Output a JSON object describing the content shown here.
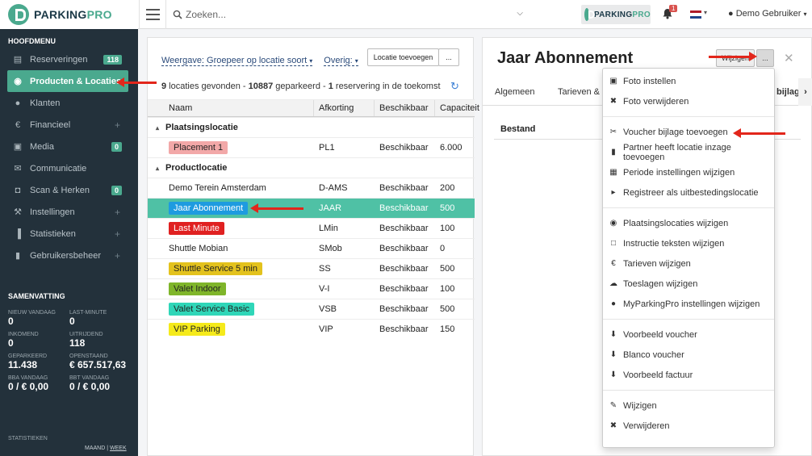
{
  "topbar": {
    "logo_text_dark": "PARKING",
    "logo_text_accent": "PRO",
    "search_placeholder": "Zoeken...",
    "notification_count": "1",
    "user_name": "Demo Gebruiker"
  },
  "sidebar": {
    "menu_title": "HOOFDMENU",
    "items": [
      {
        "label": "Reserveringen",
        "icon": "chart-icon",
        "badge": "118"
      },
      {
        "label": "Producten & Locaties",
        "icon": "location-pin-icon",
        "active": true
      },
      {
        "label": "Klanten",
        "icon": "user-icon"
      },
      {
        "label": "Financieel",
        "icon": "euro-icon",
        "plus": "+"
      },
      {
        "label": "Media",
        "icon": "image-icon",
        "badge": "0"
      },
      {
        "label": "Communicatie",
        "icon": "envelope-icon"
      },
      {
        "label": "Scan & Herken",
        "icon": "camera-icon",
        "badge": "0"
      },
      {
        "label": "Instellingen",
        "icon": "wrench-icon",
        "plus": "+"
      },
      {
        "label": "Statistieken",
        "icon": "bar-chart-icon",
        "plus": "+"
      },
      {
        "label": "Gebruikersbeheer",
        "icon": "briefcase-icon",
        "plus": "+"
      }
    ],
    "summary_title": "SAMENVATTING",
    "summary": [
      {
        "label": "NIEUW VANDAAG",
        "value": "0"
      },
      {
        "label": "LAST-MINUTE",
        "value": "0"
      },
      {
        "label": "INKOMEND",
        "value": "0"
      },
      {
        "label": "UITRIJDEND",
        "value": "118"
      },
      {
        "label": "GEPARKEERD",
        "value": "11.438"
      },
      {
        "label": "OPENSTAAND",
        "value": "€ 657.517,63"
      },
      {
        "label": "BBA VANDAAG",
        "value": "0 / € 0,00"
      },
      {
        "label": "BBT VANDAAG",
        "value": "0 / € 0,00"
      }
    ],
    "stats_title": "STATISTIEKEN",
    "stats_links": {
      "month": "MAAND",
      "sep": " | ",
      "week": "WEEK"
    }
  },
  "left_panel": {
    "view_label": "Weergave: Groepeer op locatie soort",
    "other_label": "Overig:",
    "add_button": "Locatie toevoegen",
    "more_button": "...",
    "count_locations": "9",
    "count_text_1": " locaties gevonden - ",
    "count_parked": "10887",
    "count_text_2": " geparkeerd - ",
    "count_reserv": "1",
    "count_text_3": " reservering in de toekomst",
    "columns": [
      "Naam",
      "Afkorting",
      "Beschikbaar",
      "Capaciteit"
    ],
    "groups": [
      {
        "name": "Plaatsingslocatie",
        "rows": [
          {
            "name": "Placement 1",
            "abbr": "PL1",
            "avail": "Beschikbaar",
            "cap": "6.000",
            "color": "#f2a8a8"
          }
        ]
      },
      {
        "name": "Productlocatie",
        "rows": [
          {
            "name": "Demo Terein Amsterdam",
            "abbr": "D-AMS",
            "avail": "Beschikbaar",
            "cap": "200",
            "color": ""
          },
          {
            "name": "Jaar Abonnement",
            "abbr": "JAAR",
            "avail": "Beschikbaar",
            "cap": "500",
            "color": "#1e9be0",
            "selected": true
          },
          {
            "name": "Last Minute",
            "abbr": "LMin",
            "avail": "Beschikbaar",
            "cap": "100",
            "color": "#e02121"
          },
          {
            "name": "Shuttle Mobian",
            "abbr": "SMob",
            "avail": "Beschikbaar",
            "cap": "0",
            "color": ""
          },
          {
            "name": "Shuttle Service 5 min",
            "abbr": "SS",
            "avail": "Beschikbaar",
            "cap": "500",
            "color": "#e3c21d"
          },
          {
            "name": "Valet Indoor",
            "abbr": "V-I",
            "avail": "Beschikbaar",
            "cap": "100",
            "color": "#7fb52a"
          },
          {
            "name": "Valet Service Basic",
            "abbr": "VSB",
            "avail": "Beschikbaar",
            "cap": "500",
            "color": "#2fd6b8"
          },
          {
            "name": "VIP Parking",
            "abbr": "VIP",
            "avail": "Beschikbaar",
            "cap": "150",
            "color": "#f5ea1b"
          }
        ]
      }
    ]
  },
  "right_panel": {
    "title": "Jaar Abonnement",
    "edit_button": "Wijzigen",
    "more_button": "...",
    "tabs": [
      "Algemeen",
      "Tarieven & T",
      "bijlag"
    ],
    "section": "Bestand"
  },
  "dropdown": {
    "groups": [
      [
        {
          "label": "Foto instellen",
          "icon": "image-icon"
        },
        {
          "label": "Foto verwijderen",
          "icon": "close-icon"
        }
      ],
      [
        {
          "label": "Voucher bijlage toevoegen",
          "icon": "paperclip-icon"
        },
        {
          "label": "Partner heeft locatie inzage toevoegen",
          "icon": "briefcase-icon"
        },
        {
          "label": "Periode instellingen wijzigen",
          "icon": "calendar-icon"
        },
        {
          "label": "Registreer als uitbestedingslocatie",
          "icon": "tags-icon"
        }
      ],
      [
        {
          "label": "Plaatsingslocaties wijzigen",
          "icon": "location-pin-icon"
        },
        {
          "label": "Instructie teksten wijzigen",
          "icon": "document-icon"
        },
        {
          "label": "Tarieven wijzigen",
          "icon": "euro-icon"
        },
        {
          "label": "Toeslagen wijzigen",
          "icon": "cloud-icon"
        },
        {
          "label": "MyParkingPro instellingen wijzigen",
          "icon": "user-icon"
        }
      ],
      [
        {
          "label": "Voorbeeld voucher",
          "icon": "download-icon"
        },
        {
          "label": "Blanco voucher",
          "icon": "download-icon"
        },
        {
          "label": "Voorbeeld factuur",
          "icon": "download-icon"
        }
      ],
      [
        {
          "label": "Wijzigen",
          "icon": "pencil-icon"
        },
        {
          "label": "Verwijderen",
          "icon": "close-icon"
        }
      ]
    ]
  },
  "colors": {
    "accent": "#4aa98e",
    "sidebar": "#23313b",
    "annotation_arrow": "#e2261b",
    "selected_row": "#4fc1a5"
  }
}
